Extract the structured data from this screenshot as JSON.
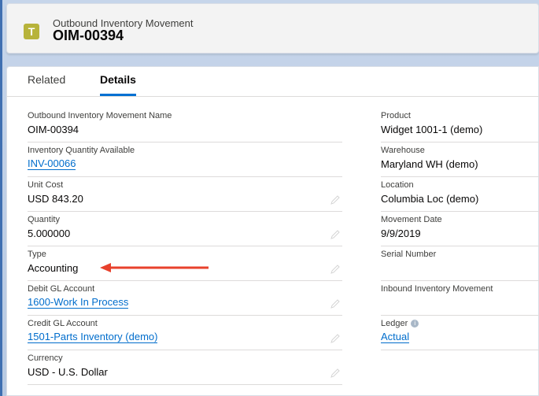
{
  "header": {
    "icon_glyph": "T",
    "icon_color": "#b7b33a",
    "object_type": "Outbound Inventory Movement",
    "record_name": "OIM-00394"
  },
  "tabs": [
    {
      "label": "Related",
      "active": false
    },
    {
      "label": "Details",
      "active": true
    }
  ],
  "left_fields": [
    {
      "label": "Outbound Inventory Movement Name",
      "value": "OIM-00394",
      "link": false,
      "editable": false
    },
    {
      "label": "Inventory Quantity Available",
      "value": "INV-00066",
      "link": true,
      "editable": false
    },
    {
      "label": "Unit Cost",
      "value": "USD 843.20",
      "link": false,
      "editable": true
    },
    {
      "label": "Quantity",
      "value": "5.000000",
      "link": false,
      "editable": true
    },
    {
      "label": "Type",
      "value": "Accounting",
      "link": false,
      "editable": true
    },
    {
      "label": "Debit GL Account",
      "value": "1600-Work In Process",
      "link": true,
      "editable": true
    },
    {
      "label": "Credit GL Account",
      "value": "1501-Parts Inventory (demo)",
      "link": true,
      "editable": true
    },
    {
      "label": "Currency",
      "value": "USD - U.S. Dollar",
      "link": false,
      "editable": true
    }
  ],
  "right_fields": [
    {
      "label": "Product",
      "value": "Widget 1001-1 (demo)",
      "link": false
    },
    {
      "label": "Warehouse",
      "value": "Maryland WH (demo)",
      "link": false
    },
    {
      "label": "Location",
      "value": "Columbia Loc (demo)",
      "link": false
    },
    {
      "label": "Movement Date",
      "value": "9/9/2019",
      "link": false
    },
    {
      "label": "Serial Number",
      "value": "",
      "link": false
    },
    {
      "label": "Inbound Inventory Movement",
      "value": "",
      "link": false
    },
    {
      "label": "Ledger",
      "value": "Actual",
      "link": true,
      "info": true
    }
  ],
  "annotation": {
    "arrow_color": "#e8412c"
  },
  "colors": {
    "link": "#006dcc",
    "active_tab": "#0070d2"
  }
}
